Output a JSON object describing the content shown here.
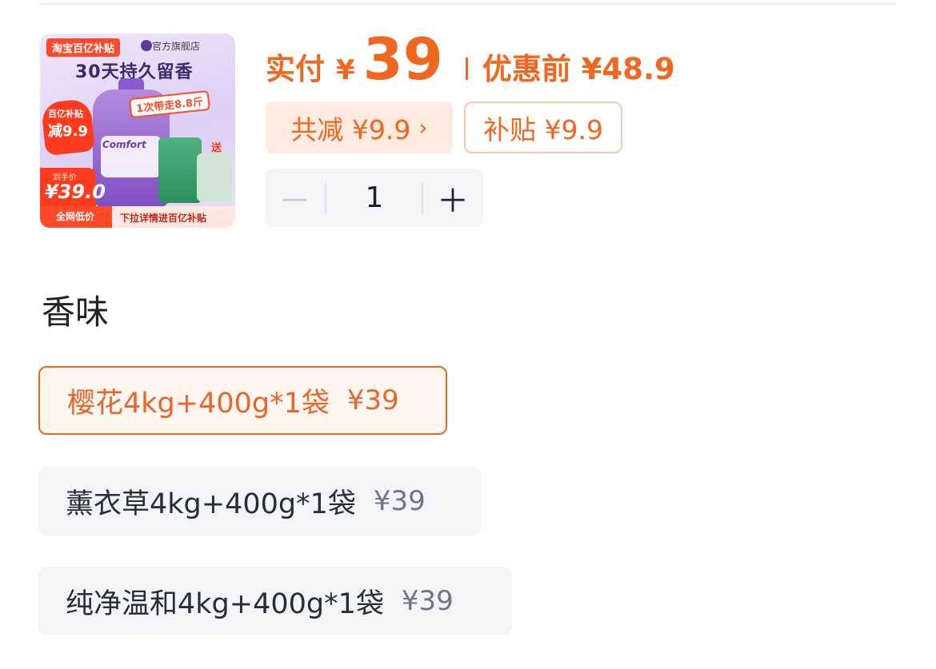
{
  "product_image": {
    "tag": "淘宝百亿补贴",
    "brand": "官方旗舰店",
    "headline": "30天持久留香",
    "flame_line1": "百亿补贴",
    "flame_line2": "减9.9",
    "slogan": "1次带走8.8斤",
    "bottle_brand": "Comfort",
    "gift": "送",
    "price_caption": "到手价",
    "price": "¥39.0",
    "bottom_left": "全网低价",
    "bottom_right": "下拉详情进百亿补贴"
  },
  "price": {
    "paid_label": "实付",
    "currency": "¥",
    "paid_value": "39",
    "before_label": "优惠前 ¥48.9"
  },
  "discounts": {
    "total_label": "共减 ¥9.9",
    "total_chevron": "›",
    "subsidy_label": "补贴 ¥9.9"
  },
  "quantity": {
    "minus": "－",
    "value": "1",
    "plus": "＋"
  },
  "scent": {
    "title": "香味",
    "options": [
      {
        "label": "樱花4kg+400g*1袋",
        "price": "¥39",
        "selected": true
      },
      {
        "label": "薰衣草4kg+400g*1袋",
        "price": "¥39",
        "selected": false
      },
      {
        "label": "纯净温和4kg+400g*1袋",
        "price": "¥39",
        "selected": false
      }
    ]
  },
  "colors": {
    "accent": "#f2671f",
    "chip_bg": "#fdebe0",
    "option_bg": "#f4f5f7"
  }
}
